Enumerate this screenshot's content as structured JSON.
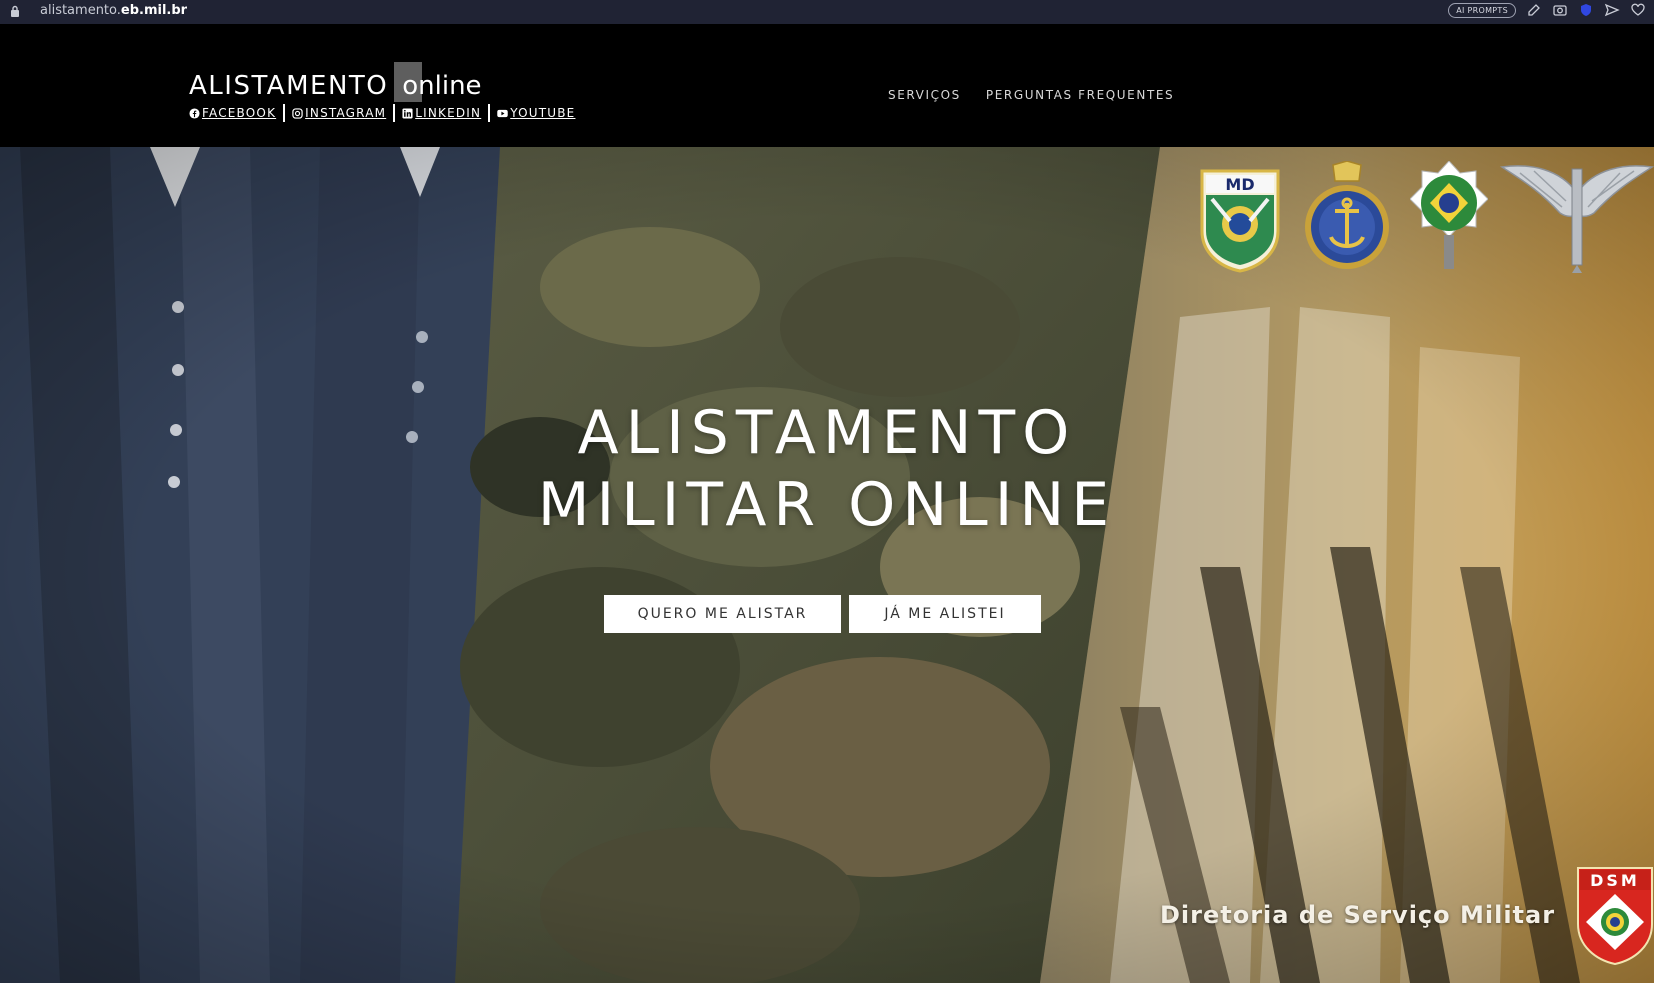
{
  "browser": {
    "url_prefix": "alistamento.",
    "url_domain": "eb.mil.br",
    "ai_badge": "AI PROMPTS"
  },
  "header": {
    "brand_main": "ALISTAMENTO",
    "brand_suffix": "online",
    "socials": [
      {
        "label": "FACEBOOK",
        "icon": "facebook-icon"
      },
      {
        "label": "INSTAGRAM",
        "icon": "instagram-icon"
      },
      {
        "label": "LINKEDIN",
        "icon": "linkedin-icon"
      },
      {
        "label": "YOUTUBE",
        "icon": "youtube-icon"
      }
    ],
    "nav": [
      {
        "label": "SERVIÇOS"
      },
      {
        "label": "PERGUNTAS FREQUENTES"
      }
    ]
  },
  "hero": {
    "title_line1": "ALISTAMENTO",
    "title_line2": "MILITAR ONLINE",
    "buttons": {
      "primary": "QUERO ME ALISTAR",
      "secondary": "JÁ ME ALISTEI"
    },
    "emblems": [
      {
        "name": "md-emblem",
        "text": "MD"
      },
      {
        "name": "marinha-emblem"
      },
      {
        "name": "exercito-emblem"
      },
      {
        "name": "aeronautica-emblem"
      }
    ],
    "footer_label": "Diretoria de Serviço Militar",
    "dsm_badge": "DSM"
  },
  "colors": {
    "header_bg": "#000000",
    "browser_bg": "#202334",
    "button_bg": "#ffffff",
    "hero_left": "#2e3a4d",
    "hero_right": "#c59a4c"
  }
}
